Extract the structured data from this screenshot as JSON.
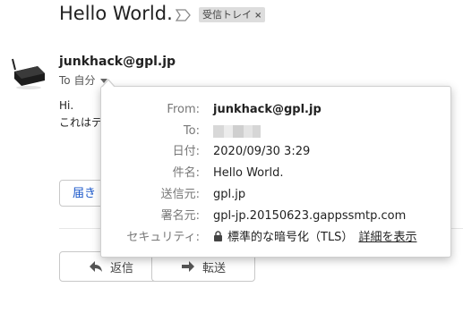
{
  "header": {
    "subject": "Hello World.",
    "label_chip": "受信トレイ",
    "label_remove_glyph": "×"
  },
  "sender": {
    "email": "junkhack@gpl.jp",
    "to_prefix": "To",
    "to_name": "自分"
  },
  "body": {
    "lines": [
      "Hi.",
      "これはテ"
    ]
  },
  "delivered_button": "届き",
  "actions": {
    "reply": "返信",
    "forward": "転送"
  },
  "details": {
    "from_label": "From:",
    "from_value": "junkhack@gpl.jp",
    "to_label": "To:",
    "date_label": "日付:",
    "date_value": "2020/09/30 3:29",
    "subject_label": "件名:",
    "subject_value": "Hello World.",
    "mailed_by_label": "送信元:",
    "mailed_by_value": "gpl.jp",
    "signed_by_label": "署名元:",
    "signed_by_value": "gpl-jp.20150623.gappssmtp.com",
    "security_label": "セキュリティ:",
    "security_value": "標準的な暗号化（TLS）",
    "security_link": "詳細を表示"
  },
  "colors": {
    "accent_link": "#1a57c9",
    "label_chip_bg": "#dddddd"
  },
  "icons": [
    "importance-marker-icon",
    "avatar-device-icon",
    "dropdown-caret-icon",
    "reply-arrow-icon",
    "forward-arrow-icon",
    "lock-icon"
  ]
}
